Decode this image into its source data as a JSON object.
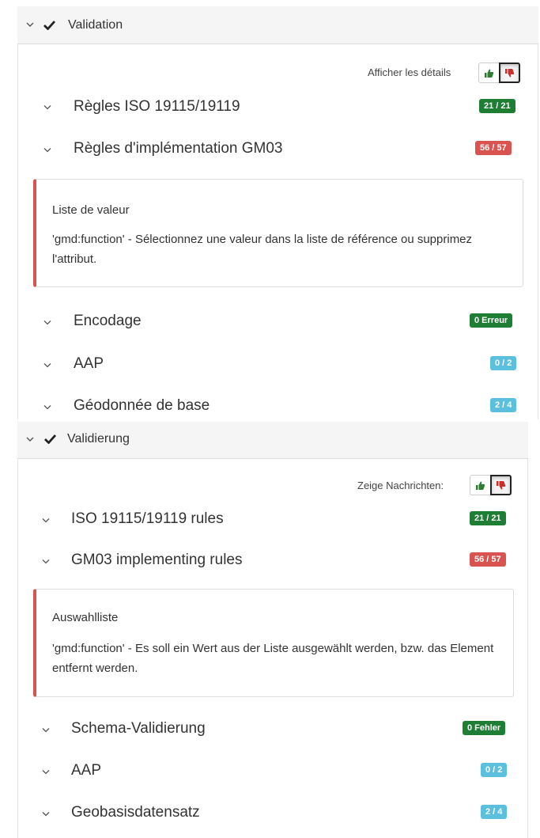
{
  "colors": {
    "success": "#1e7e34",
    "danger": "#d9534f",
    "info": "#5bc0de",
    "thumb_up": "#2e7d32",
    "thumb_down": "#c9302c"
  },
  "panel_fr": {
    "title": "Validation",
    "show_details_label": "Afficher les détails",
    "rules": [
      {
        "label": "Règles ISO 19115/19119",
        "badge": "21 / 21",
        "status": "success"
      },
      {
        "label": "Règles d'implémentation GM03",
        "badge": "56 / 57",
        "status": "danger"
      },
      {
        "label": "Encodage",
        "badge": "0 Erreur",
        "status": "success"
      },
      {
        "label": "AAP",
        "badge": "0 / 2",
        "status": "info"
      },
      {
        "label": "Géodonnée de base",
        "badge": "2 / 4",
        "status": "info"
      }
    ],
    "message": {
      "title": "Liste de valeur",
      "text": "'gmd:function' - Sélectionnez une valeur dans la liste de référence ou supprimez l'attribut."
    }
  },
  "panel_de": {
    "title": "Validierung",
    "show_details_label": "Zeige Nachrichten:",
    "rules": [
      {
        "label": "ISO 19115/19119 rules",
        "badge": "21 / 21",
        "status": "success"
      },
      {
        "label": "GM03 implementing rules",
        "badge": "56 / 57",
        "status": "danger"
      },
      {
        "label": "Schema-Validierung",
        "badge": "0 Fehler",
        "status": "success"
      },
      {
        "label": "AAP",
        "badge": "0 / 2",
        "status": "info"
      },
      {
        "label": "Geobasisdatensatz",
        "badge": "2 / 4",
        "status": "info"
      }
    ],
    "message": {
      "title": "Auswahlliste",
      "text": "'gmd:function' - Es soll ein Wert aus der Liste ausgewählt werden, bzw. das Element entfernt werden."
    }
  }
}
